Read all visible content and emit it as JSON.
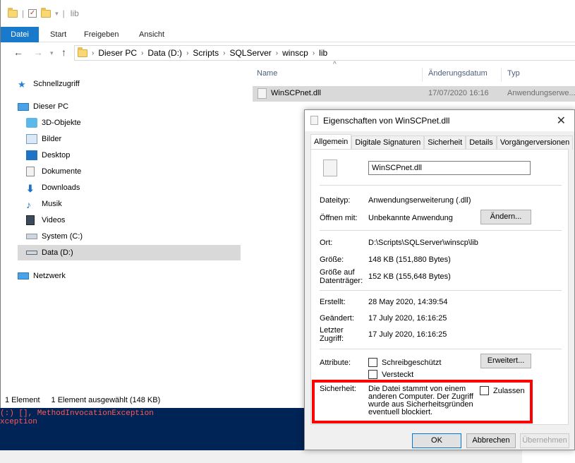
{
  "powershell": {
    "line1": "(:) [], MethodInvocationException",
    "line2": "xception"
  },
  "explorer": {
    "title": "lib",
    "ribbon_tabs": [
      "Datei",
      "Start",
      "Freigeben",
      "Ansicht"
    ],
    "breadcrumb": [
      "Dieser PC",
      "Data (D:)",
      "Scripts",
      "SQLServer",
      "winscp",
      "lib"
    ],
    "nav": {
      "quick_access": "Schnellzugriff",
      "this_pc": "Dieser PC",
      "objects3d": "3D-Objekte",
      "pictures": "Bilder",
      "desktop": "Desktop",
      "documents": "Dokumente",
      "downloads": "Downloads",
      "music": "Musik",
      "videos": "Videos",
      "system_c": "System (C:)",
      "data_d": "Data (D:)",
      "network": "Netzwerk"
    },
    "columns": {
      "name": "Name",
      "modified": "Änderungsdatum",
      "type": "Typ"
    },
    "file": {
      "name": "WinSCPnet.dll",
      "modified": "17/07/2020 16:16",
      "type": "Anwendungserwe..."
    },
    "status": {
      "count": "1 Element",
      "selected": "1 Element ausgewählt (148 KB)"
    }
  },
  "dialog": {
    "title": "Eigenschaften von WinSCPnet.dll",
    "tabs": [
      "Allgemein",
      "Digitale Signaturen",
      "Sicherheit",
      "Details",
      "Vorgängerversionen"
    ],
    "filename": "WinSCPnet.dll",
    "filetype_label": "Dateityp:",
    "filetype_value": "Anwendungserweiterung (.dll)",
    "opens_with_label": "Öffnen mit:",
    "opens_with_value": "Unbekannte Anwendung",
    "change_button": "Ändern...",
    "location_label": "Ort:",
    "location_value": "D:\\Scripts\\SQLServer\\winscp\\lib",
    "size_label": "Größe:",
    "size_value": "148 KB (151,880 Bytes)",
    "size_on_disk_label_1": "Größe auf",
    "size_on_disk_label_2": "Datenträger:",
    "size_on_disk_value": "152 KB (155,648 Bytes)",
    "created_label": "Erstellt:",
    "created_value": "28 May 2020, 14:39:54",
    "modified_label": "Geändert:",
    "modified_value": "17 July 2020, 16:16:25",
    "accessed_label_1": "Letzter",
    "accessed_label_2": "Zugriff:",
    "accessed_value": "17 July 2020, 16:16:25",
    "attributes_label": "Attribute:",
    "readonly_label": "Schreibgeschützt",
    "hidden_label": "Versteckt",
    "advanced_button": "Erweitert...",
    "security_label": "Sicherheit:",
    "security_text_1": "Die Datei stammt von einem",
    "security_text_2": "anderen Computer. Der Zugriff",
    "security_text_3": "wurde aus Sicherheitsgründen",
    "security_text_4": "eventuell blockiert.",
    "unblock_label": "Zulassen",
    "ok_button": "OK",
    "cancel_button": "Abbrechen",
    "apply_button": "Übernehmen"
  },
  "colors": {
    "accent": "#1979ca",
    "highlight": "#ff0000",
    "ps_bg": "#012456"
  }
}
